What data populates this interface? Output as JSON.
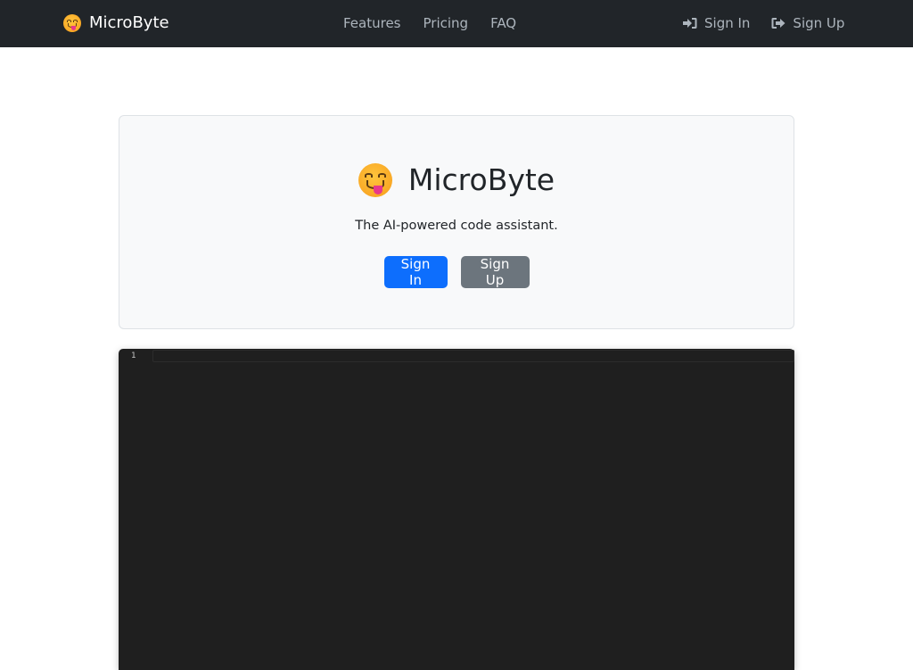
{
  "navbar": {
    "brand": "MicroByte",
    "brand_icon": "face-savoring-food-emoji",
    "links": [
      "Features",
      "Pricing",
      "FAQ"
    ],
    "sign_in": {
      "label": "Sign In",
      "icon": "sign-in-icon"
    },
    "sign_up": {
      "label": "Sign Up",
      "icon": "sign-out-icon"
    }
  },
  "hero": {
    "title": "MicroByte",
    "title_icon": "face-savoring-food-emoji",
    "subtitle": "The AI-powered code assistant.",
    "sign_in_label": "Sign In",
    "sign_up_label": "Sign Up"
  },
  "editor": {
    "line_numbers": [
      "1"
    ],
    "content": ""
  },
  "colors": {
    "navbar_bg": "#212529",
    "primary": "#0d6efd",
    "secondary": "#6c757d",
    "editor_bg": "#1f1f1f",
    "hero_bg": "#f8f9fa"
  }
}
